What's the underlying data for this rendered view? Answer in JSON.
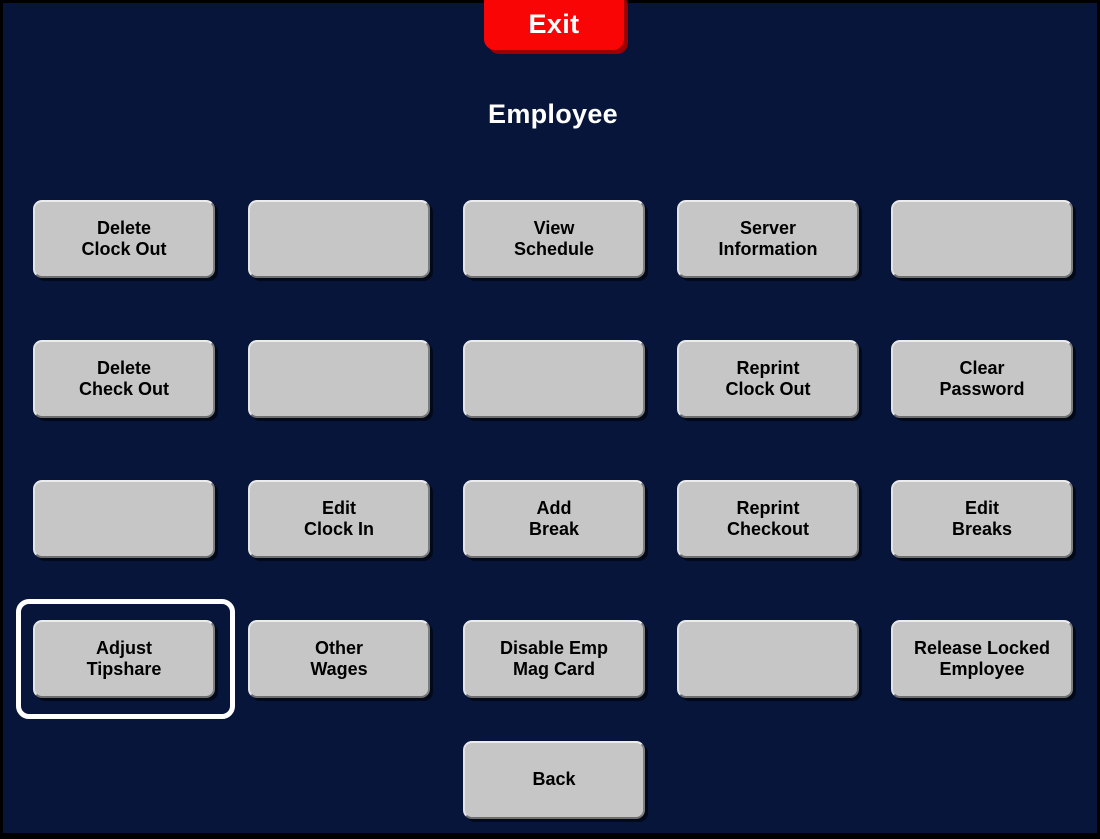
{
  "window": {
    "title": "Employee",
    "background_color": "#061539",
    "border_color": "#000000"
  },
  "exit": {
    "label": "Exit",
    "color": "#fa0505",
    "shadow_color": "#9c0000",
    "text_color": "#ffffff"
  },
  "header": {
    "title": "Employee",
    "text_color": "#ffffff"
  },
  "button_style": {
    "face_color": "#c6c6c6",
    "text_color": "#000000",
    "highlight_color": "#ececec",
    "shade_color": "#6e6e6e"
  },
  "selection": {
    "target": "Adjust\nTipshare",
    "outline_color": "#ffffff"
  },
  "grid": {
    "rows": 4,
    "columns": 5,
    "buttons": [
      {
        "label": "Delete\nClock Out",
        "row": 0,
        "col": 0,
        "empty": false
      },
      {
        "label": "",
        "row": 0,
        "col": 1,
        "empty": true
      },
      {
        "label": "View\nSchedule",
        "row": 0,
        "col": 2,
        "empty": false
      },
      {
        "label": "Server\nInformation",
        "row": 0,
        "col": 3,
        "empty": false
      },
      {
        "label": "",
        "row": 0,
        "col": 4,
        "empty": true
      },
      {
        "label": "Delete\nCheck Out",
        "row": 1,
        "col": 0,
        "empty": false
      },
      {
        "label": "",
        "row": 1,
        "col": 1,
        "empty": true
      },
      {
        "label": "",
        "row": 1,
        "col": 2,
        "empty": true
      },
      {
        "label": "Reprint\nClock Out",
        "row": 1,
        "col": 3,
        "empty": false
      },
      {
        "label": "Clear\nPassword",
        "row": 1,
        "col": 4,
        "empty": false
      },
      {
        "label": "",
        "row": 2,
        "col": 0,
        "empty": true
      },
      {
        "label": "Edit\nClock In",
        "row": 2,
        "col": 1,
        "empty": false
      },
      {
        "label": "Add\nBreak",
        "row": 2,
        "col": 2,
        "empty": false
      },
      {
        "label": "Reprint\nCheckout",
        "row": 2,
        "col": 3,
        "empty": false
      },
      {
        "label": "Edit\nBreaks",
        "row": 2,
        "col": 4,
        "empty": false
      },
      {
        "label": "Adjust\nTipshare",
        "row": 3,
        "col": 0,
        "empty": false
      },
      {
        "label": "Other\nWages",
        "row": 3,
        "col": 1,
        "empty": false
      },
      {
        "label": "Disable Emp\nMag Card",
        "row": 3,
        "col": 2,
        "empty": false
      },
      {
        "label": "",
        "row": 3,
        "col": 3,
        "empty": true
      },
      {
        "label": "Release Locked\nEmployee",
        "row": 3,
        "col": 4,
        "empty": false
      }
    ]
  },
  "footer": {
    "back_label": "Back"
  }
}
